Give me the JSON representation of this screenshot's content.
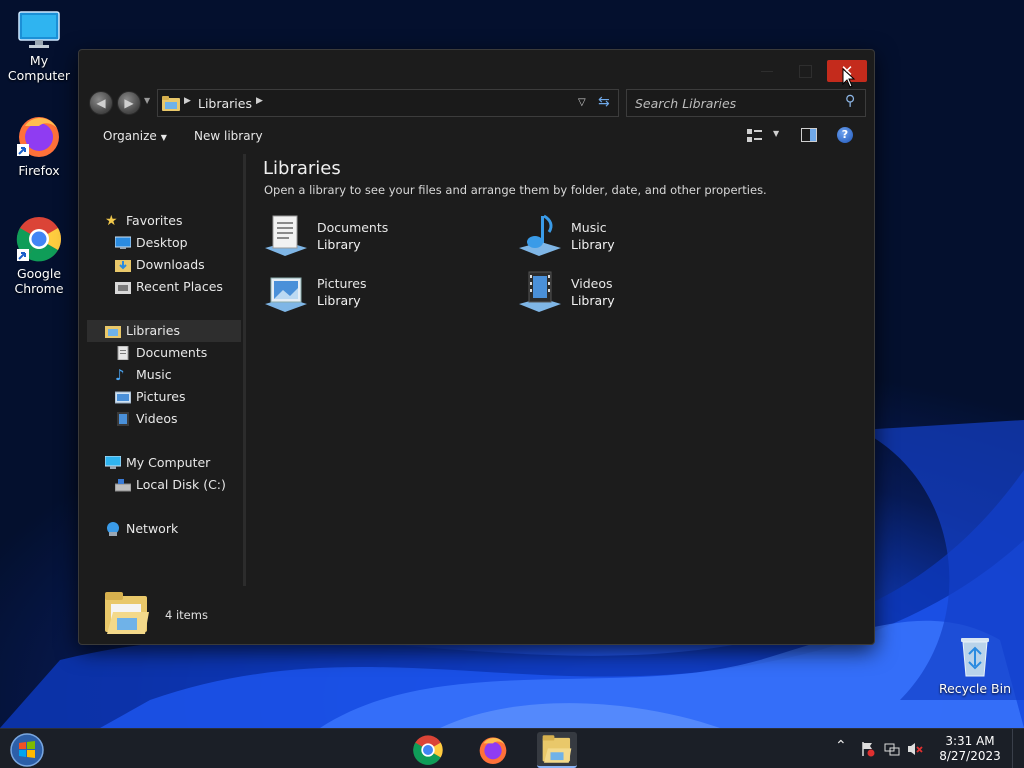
{
  "desktop": {
    "icons": [
      {
        "label_line1": "My",
        "label_line2": "Computer"
      },
      {
        "label_line1": "Firefox",
        "label_line2": ""
      },
      {
        "label_line1": "Google",
        "label_line2": "Chrome"
      },
      {
        "label_line1": "Recycle Bin",
        "label_line2": ""
      }
    ]
  },
  "window": {
    "address": {
      "crumb": "Libraries"
    },
    "search": {
      "placeholder": "Search Libraries"
    },
    "toolbar": {
      "organize_label": "Organize",
      "new_library_label": "New library",
      "help_glyph": "?"
    },
    "nav": {
      "favorites": {
        "label": "Favorites",
        "items": [
          "Desktop",
          "Downloads",
          "Recent Places"
        ]
      },
      "libraries": {
        "label": "Libraries",
        "items": [
          "Documents",
          "Music",
          "Pictures",
          "Videos"
        ]
      },
      "computer": {
        "label": "My Computer",
        "items": [
          "Local Disk (C:)"
        ]
      },
      "network": {
        "label": "Network"
      }
    },
    "content": {
      "title": "Libraries",
      "subtitle": "Open a library to see your files and arrange them by folder, date, and other properties.",
      "libraries": [
        {
          "name": "Documents",
          "type": "Library"
        },
        {
          "name": "Music",
          "type": "Library"
        },
        {
          "name": "Pictures",
          "type": "Library"
        },
        {
          "name": "Videos",
          "type": "Library"
        }
      ]
    },
    "details": {
      "count": "4 items"
    }
  },
  "taskbar": {
    "clock_time": "3:31 AM",
    "clock_date": "8/27/2023"
  },
  "colors": {
    "close_button": "#c42b1c",
    "selection": "#2e2e2e",
    "window_bg": "#1c1c1c"
  }
}
